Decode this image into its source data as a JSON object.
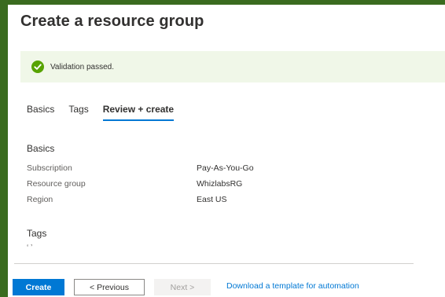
{
  "title": "Create a resource group",
  "validation": {
    "message": "Validation passed.",
    "icon": "check-circle-icon",
    "color": "#57a300",
    "background": "#f0f7e8"
  },
  "tabs": [
    {
      "label": "Basics"
    },
    {
      "label": "Tags"
    },
    {
      "label": "Review + create",
      "selected": true
    }
  ],
  "basics": {
    "heading": "Basics",
    "rows": [
      {
        "label": "Subscription",
        "value": "Pay-As-You-Go"
      },
      {
        "label": "Resource group",
        "value": "WhizlabsRG"
      },
      {
        "label": "Region",
        "value": "East US"
      }
    ]
  },
  "tags": {
    "heading": "Tags",
    "value": "‘ ’"
  },
  "footer": {
    "create_label": "Create",
    "previous_label": "< Previous",
    "next_label": "Next >",
    "download_label": "Download a template for automation"
  },
  "colors": {
    "accent": "#0078d4",
    "frame": "#3a6b1f"
  }
}
